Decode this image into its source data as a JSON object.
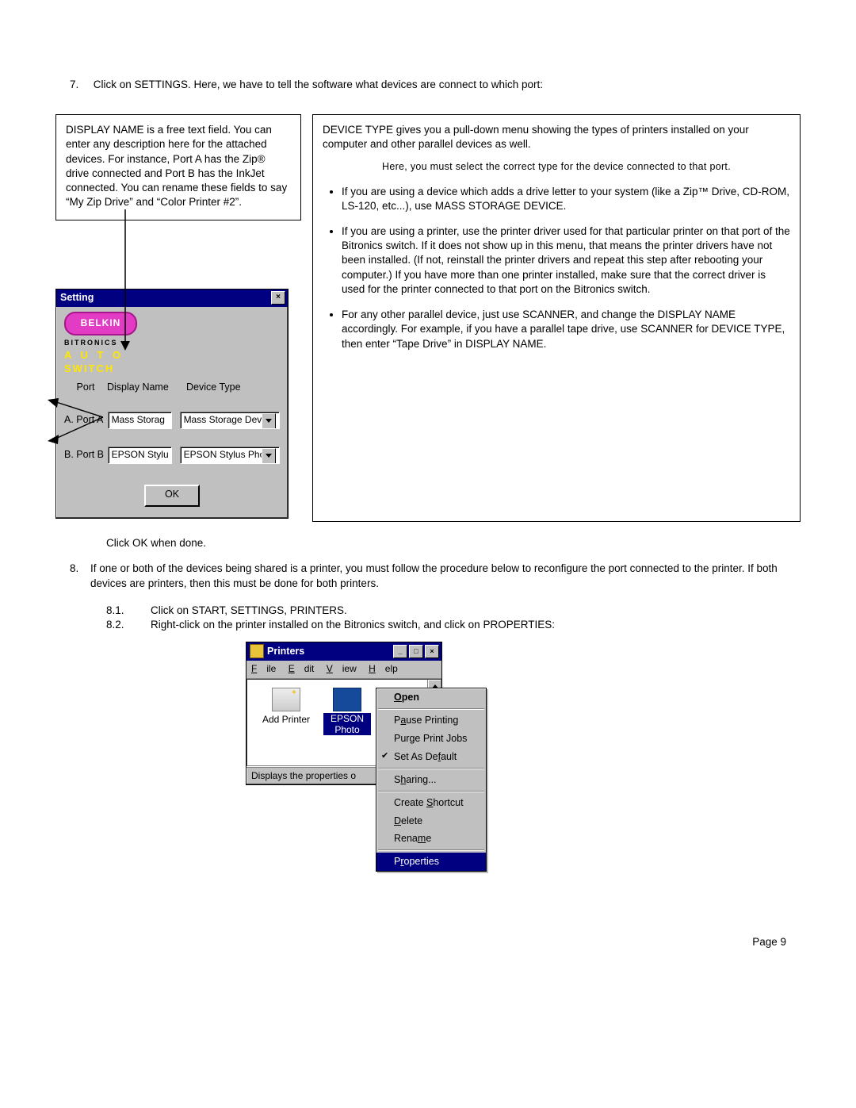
{
  "step7_num": "7.",
  "step7_text": "Click on SETTINGS.  Here, we have to tell the software what devices are connect to which port:",
  "left_callout": "DISPLAY NAME is a free text field.  You can enter any description here for the attached devices.  For instance, Port A has the Zip® drive connected and Port B has the InkJet connected.  You can rename these fields to say “My Zip Drive” and “Color Printer #2”.",
  "right_callout": {
    "p1": "DEVICE TYPE gives you a pull-down menu showing the  types of printers installed on your computer and other parallel devices as well.",
    "emph": "Here, you must select the correct type for the device connected to that port.",
    "b1": "If you are using a device which adds a drive letter to your system (like a Zip™ Drive, CD-ROM, LS-120, etc...), use MASS STORAGE DEVICE.",
    "b2": "If you are using a printer, use the printer driver used for that particular printer on that port of the Bitronics switch.  If it does not show up in this menu, that means the printer drivers have not been installed.  (If not, reinstall the printer drivers and repeat this step after rebooting your computer.)  If you have more than one printer installed, make sure that the correct driver is used for the printer connected to that port on the Bitronics switch.",
    "b3": "For any other parallel device, just use SCANNER, and change the DISPLAY NAME accordingly.  For example, if you have a parallel tape drive, use SCANNER for DEVICE TYPE, then enter “Tape Drive” in DISPLAY NAME."
  },
  "dialog": {
    "title": "Setting",
    "close_x": "×",
    "belkin": "BELKIN",
    "bitronics": "BITRONICS",
    "auto": "A U T O",
    "switch": "SWITCH",
    "col_port": "Port",
    "col_dn": "Display Name",
    "col_dt": "Device Type",
    "rowA_label": "A. Port A",
    "rowA_dn": "Mass Storag",
    "rowA_dt": "Mass Storage Devic",
    "rowB_label": "B. Port B",
    "rowB_dn": "EPSON Stylu",
    "rowB_dt": "EPSON Stylus Phot",
    "ok": "OK"
  },
  "click_ok": "Click OK when done.",
  "step8_num": "8.",
  "step8_text": "If one or both of the devices being shared is a printer, you must follow the procedure below to reconfigure the port connected to the printer.  If both devices are printers, then this must be done for both printers.",
  "sub81_n": "8.1.",
  "sub81_t": "Click on START, SETTINGS, PRINTERS.",
  "sub82_n": "8.2.",
  "sub82_t": "Right-click on the printer installed on the Bitronics switch, and click on PROPERTIES:",
  "printers": {
    "title": "Printers",
    "menu_file": "File",
    "menu_edit": "Edit",
    "menu_view": "View",
    "menu_help": "Help",
    "add_printer": "Add Printer",
    "epson1": "EPSON",
    "epson2": "Photo",
    "statusbar": "Displays the properties o",
    "min": "_",
    "max": "□",
    "close": "×"
  },
  "ctx": {
    "open": "Open",
    "pause": "Pause Printing",
    "purge": "Purge Print Jobs",
    "default": "Set As Default",
    "sharing": "Sharing...",
    "shortcut": "Create Shortcut",
    "delete": "Delete",
    "rename": "Rename",
    "properties": "Properties"
  },
  "footer": "Page 9"
}
